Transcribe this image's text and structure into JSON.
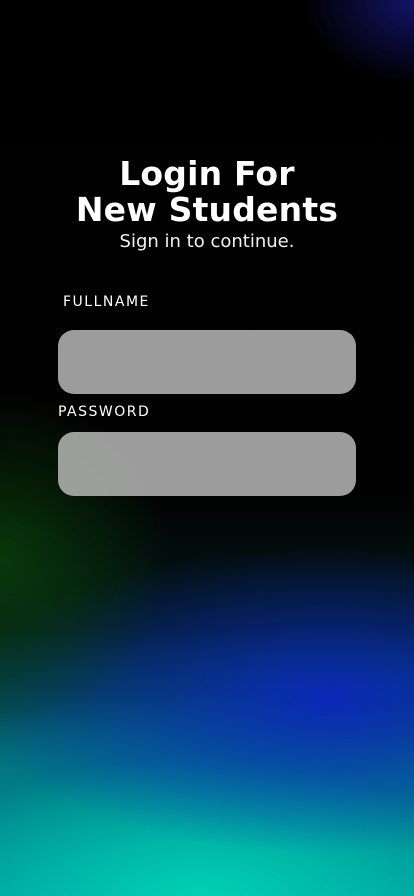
{
  "login": {
    "title_line1": "Login For",
    "title_line2": "New Students",
    "subtitle": "Sign in to continue.",
    "fullname": {
      "label": "FULLNAME",
      "value": "",
      "placeholder": ""
    },
    "password": {
      "label": "PASSWORD",
      "value": "",
      "placeholder": ""
    }
  },
  "colors": {
    "text": "#ffffff",
    "field_background": "#c8c8c8",
    "gradient_top": "#000000",
    "gradient_blue": "#0a28be",
    "gradient_teal": "#00d2b4"
  }
}
